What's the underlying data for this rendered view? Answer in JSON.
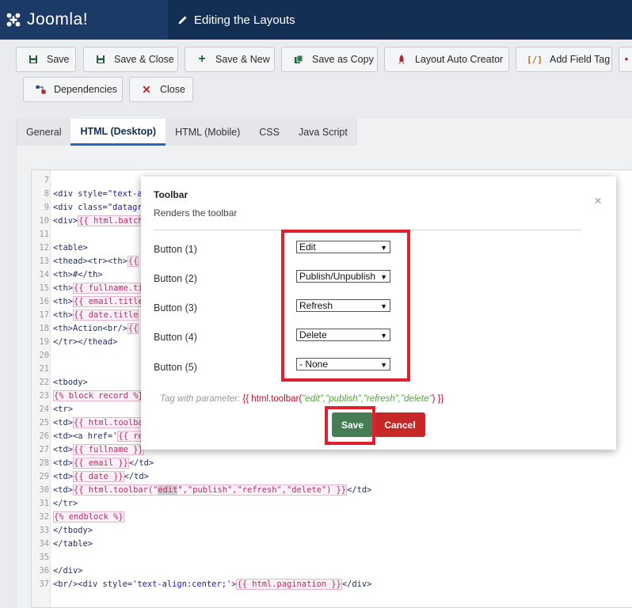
{
  "header": {
    "brand": "Joomla!",
    "title": "Editing the Layouts"
  },
  "toolbar": {
    "save": "Save",
    "save_close": "Save & Close",
    "save_new": "Save & New",
    "save_copy": "Save as Copy",
    "layout_auto_creator": "Layout Auto Creator",
    "add_field_tag": "Add Field Tag",
    "dependencies": "Dependencies",
    "close": "Close"
  },
  "tabs": [
    "General",
    "HTML (Desktop)",
    "HTML (Mobile)",
    "CSS",
    "Java Script"
  ],
  "editor": {
    "lines": [
      {
        "n": "7",
        "html": ""
      },
      {
        "n": "8",
        "html": "&lt;div style=<span class='str'>\"text-a</span>"
      },
      {
        "n": "9",
        "html": "&lt;div class=<span class='str'>\"datagr</span>"
      },
      {
        "n": "10",
        "html": "&lt;div&gt;<span class='tw'>{{ html.batch</span>"
      },
      {
        "n": "11",
        "html": ""
      },
      {
        "n": "12",
        "html": "&lt;table&gt;"
      },
      {
        "n": "13",
        "html": "&lt;thead&gt;&lt;tr&gt;&lt;th&gt;<span class='tw'>{{</span>"
      },
      {
        "n": "14",
        "html": "&lt;th&gt;#&lt;/th&gt;"
      },
      {
        "n": "15",
        "html": "&lt;th&gt;<span class='tw'>{{ fullname.ti</span>"
      },
      {
        "n": "16",
        "html": "&lt;th&gt;<span class='tw'>{{ email.title</span>"
      },
      {
        "n": "17",
        "html": "&lt;th&gt;<span class='tw'>{{ date.title</span>"
      },
      {
        "n": "18",
        "html": "&lt;th&gt;Action&lt;br/&gt;<span class='tw'>{{</span>"
      },
      {
        "n": "19",
        "html": "&lt;/tr&gt;&lt;/thead&gt;"
      },
      {
        "n": "20",
        "html": ""
      },
      {
        "n": "21",
        "html": ""
      },
      {
        "n": "22",
        "html": "&lt;tbody&gt;"
      },
      {
        "n": "23",
        "html": "<span class='tw'>{% block record %}</span>"
      },
      {
        "n": "24",
        "html": "&lt;tr&gt;"
      },
      {
        "n": "25",
        "html": "&lt;td&gt;<span class='tw'>{{ html.toolba</span>"
      },
      {
        "n": "26",
        "html": "&lt;td&gt;&lt;a href=<span class='str'>'</span><span class='tw'>{{ re</span>"
      },
      {
        "n": "27",
        "html": "&lt;td&gt;<span class='tw'>{{ fullname }}</span>"
      },
      {
        "n": "28",
        "html": "&lt;td&gt;<span class='tw'>{{ email }}</span>&lt;/td&gt;"
      },
      {
        "n": "29",
        "html": "&lt;td&gt;<span class='tw'>{{ date }}</span>&lt;/td&gt;"
      },
      {
        "n": "30",
        "html": "&lt;td&gt;<span class='tw'>{{ html.toolbar(\"<span class='sel'>edit</span>\",\"publish\",\"refresh\",\"delete\") }}</span>&lt;/td&gt;"
      },
      {
        "n": "31",
        "html": "&lt;/tr&gt;"
      },
      {
        "n": "32",
        "html": "<span class='tw'>{% endblock %}</span>"
      },
      {
        "n": "33",
        "html": "&lt;/tbody&gt;"
      },
      {
        "n": "34",
        "html": "&lt;/table&gt;"
      },
      {
        "n": "35",
        "html": ""
      },
      {
        "n": "36",
        "html": "&lt;/div&gt;"
      },
      {
        "n": "37",
        "html": "&lt;br/&gt;&lt;div style=<span class='str'>'text-align:center;'</span>&gt;<span class='tw'>{{ html.pagination }}</span>&lt;/div&gt;"
      }
    ]
  },
  "modal": {
    "title": "Toolbar",
    "subtitle": "Renders the toolbar",
    "close_glyph": "×",
    "fields": [
      {
        "label": "Button (1)",
        "value": "Edit"
      },
      {
        "label": "Button (2)",
        "value": "Publish/Unpublish"
      },
      {
        "label": "Button (3)",
        "value": "Refresh"
      },
      {
        "label": "Button (4)",
        "value": "Delete"
      },
      {
        "label": "Button (5)",
        "value": "- None"
      }
    ],
    "tag_prefix": "Tag with parameter:",
    "tag_code_open": "{{ html.toolbar(",
    "tag_args": "\"edit\",\"publish\",\"refresh\",\"delete\"",
    "tag_code_close": ") }}",
    "save_label": "Save",
    "cancel_label": "Cancel"
  },
  "colors": {
    "header_bg": "#132f53",
    "brand_bg": "#1b3a66",
    "highlight": "#e0202c",
    "save_button": "#457d54",
    "cancel_button": "#c52827"
  },
  "icons": {
    "brand": "joomla-logo",
    "title": "pencil-icon",
    "save": "floppy-icon",
    "save_new": "plus-icon",
    "save_copy": "copy-icon",
    "auto_creator": "rocket-icon",
    "field_tag": "brackets-icon",
    "dependencies": "dependencies-icon",
    "close": "times-icon"
  }
}
